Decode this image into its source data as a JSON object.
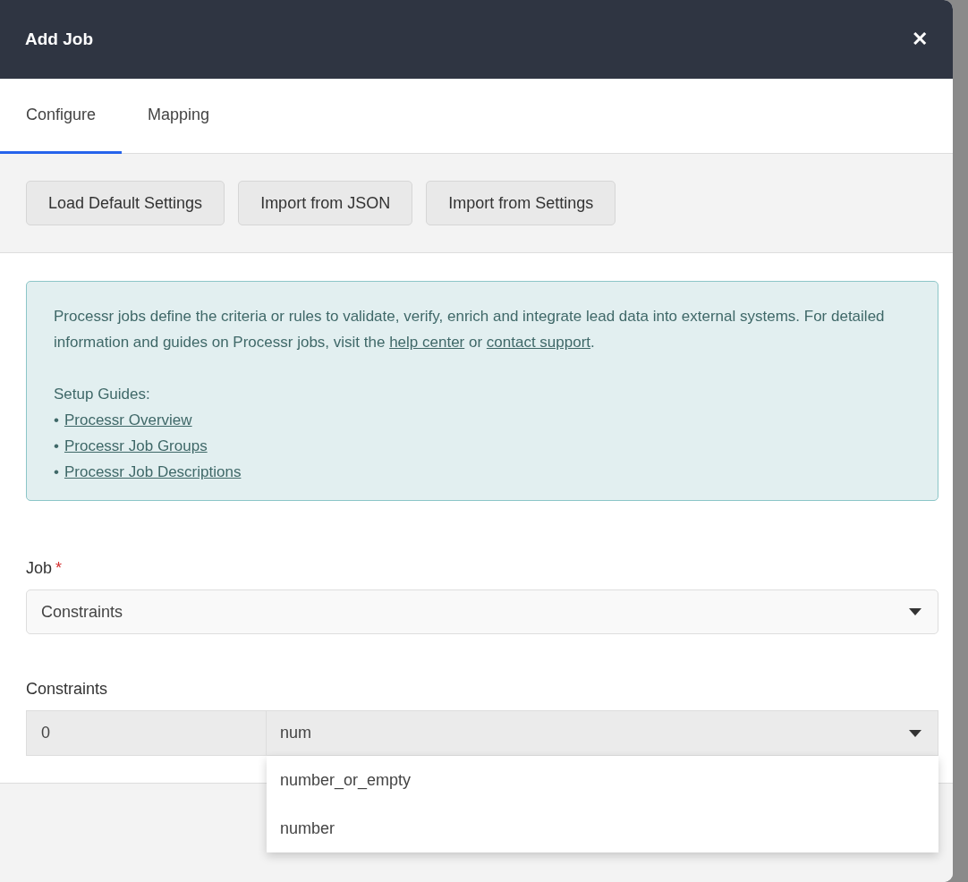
{
  "window": {
    "title": "Add Job",
    "close": "✕"
  },
  "tabs": [
    {
      "label": "Configure",
      "selected": true
    },
    {
      "label": "Mapping",
      "selected": false
    }
  ],
  "toolbar": {
    "buttons": [
      "Load Default Settings",
      "Import from JSON",
      "Import from Settings"
    ]
  },
  "info": {
    "text_before": "Processr jobs define the criteria or rules to validate, verify, enrich and integrate lead data into external systems. For detailed information and guides on Processr jobs, visit the ",
    "link_1": "help center",
    "text_middle": " or ",
    "link_2": "contact support",
    "text_after": ".",
    "guides_label": "Setup Guides:",
    "guides": [
      {
        "bullet": "•",
        "label": "Processr Overview"
      },
      {
        "bullet": "•",
        "label": "Processr Job Groups"
      },
      {
        "bullet": "•",
        "label": "Processr Job Descriptions"
      }
    ]
  },
  "job": {
    "label": "Job",
    "required_mark": "*",
    "value": "Constraints"
  },
  "constraints": {
    "label": "Constraints",
    "index": "0",
    "value": "num",
    "options": [
      "number_or_empty",
      "number"
    ]
  }
}
